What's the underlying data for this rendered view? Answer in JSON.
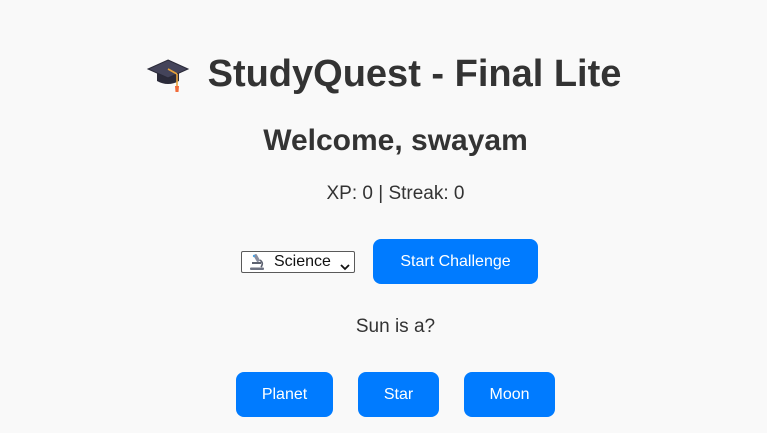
{
  "header": {
    "icon": "graduation-cap-icon",
    "title": "StudyQuest - Final Lite"
  },
  "welcome": "Welcome, swayam",
  "stats": "XP: 0 | Streak: 0",
  "subject_select": {
    "icon": "microscope-icon",
    "selected": "Science"
  },
  "start_button": "Start Challenge",
  "question": "Sun is a?",
  "options": [
    "Planet",
    "Star",
    "Moon"
  ],
  "colors": {
    "accent": "#007bff",
    "text": "#333333",
    "background": "#f9f9f9"
  }
}
